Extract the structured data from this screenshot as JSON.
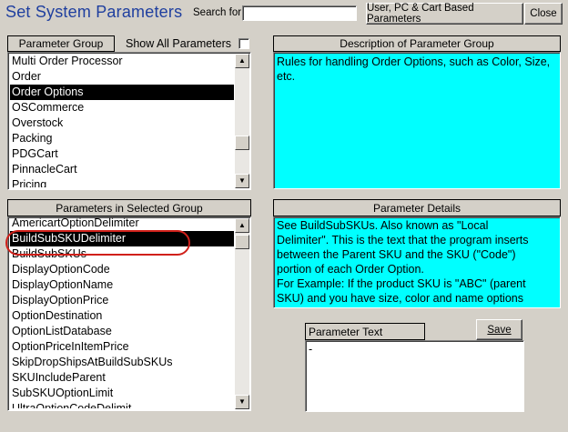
{
  "window": {
    "title": "Set System Parameters"
  },
  "search": {
    "label": "Search for:",
    "value": ""
  },
  "buttons": {
    "user_pc_cart": "User, PC & Cart Based Parameters",
    "close": "Close",
    "save": "Save"
  },
  "parameter_group": {
    "header": "Parameter Group",
    "show_all_label": "Show All Parameters",
    "show_all_checked": false,
    "items": [
      "Multi Order Processor",
      "Order",
      "Order Options",
      "OSCommerce",
      "Overstock",
      "Packing",
      "PDGCart",
      "PinnacleCart",
      "Pricing"
    ],
    "selected": "Order Options"
  },
  "description": {
    "header": "Description of Parameter Group",
    "text": "Rules for handling Order Options, such as Color, Size, etc."
  },
  "parameters": {
    "header": "Parameters in Selected Group",
    "items": [
      "AmericartOptionDelimiter",
      "BuildSubSKUDelimiter",
      "BuildSubSKUs",
      "DisplayOptionCode",
      "DisplayOptionName",
      "DisplayOptionPrice",
      "OptionDestination",
      "OptionListDatabase",
      "OptionPriceInItemPrice",
      "SkipDropShipsAtBuildSubSKUs",
      "SKUIncludeParent",
      "SubSKUOptionLimit",
      "UltraOptionCodeDelimit"
    ],
    "selected": "BuildSubSKUDelimiter"
  },
  "details": {
    "header": "Parameter Details",
    "lines": [
      "See BuildSubSKUs. Also known as \"Local",
      "Delimiter\". This is the text that the program inserts",
      "between the Parent SKU and the SKU (\"Code\")",
      "portion of each Order Option.",
      "For Example: If the product SKU is \"ABC\" (parent",
      "SKU) and you have size, color and name options"
    ]
  },
  "parameter_text": {
    "header": "Parameter Text",
    "value": "-"
  },
  "colors": {
    "title": "#1f3f9f",
    "description_bg": "#00ffff",
    "highlight_ring": "#d0201a"
  }
}
